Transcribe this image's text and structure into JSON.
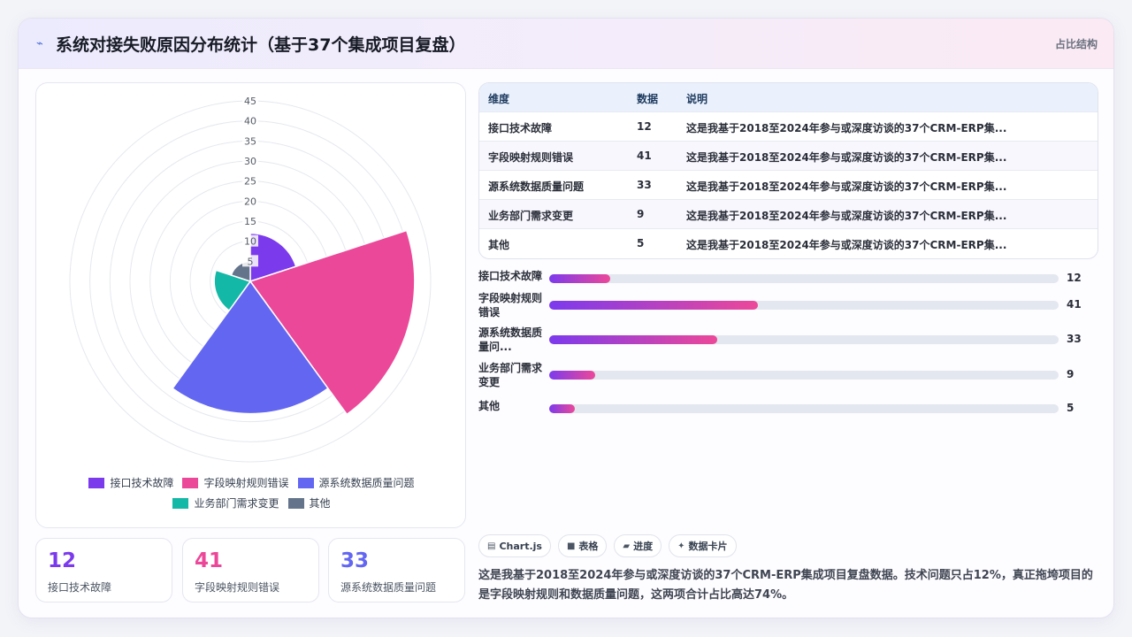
{
  "header": {
    "logo_icon": "line-chart-icon",
    "title": "系统对接失败原因分布统计（基于37个集成项目复盘）",
    "tag": "占比结构"
  },
  "chart_data": {
    "type": "polarArea",
    "categories": [
      "接口技术故障",
      "字段映射规则错误",
      "源系统数据质量问题",
      "业务部门需求变更",
      "其他"
    ],
    "values": [
      12,
      41,
      33,
      9,
      5
    ],
    "colors": [
      "#7c3aed",
      "#ec4899",
      "#6366f1",
      "#14b8a6",
      "#64748b"
    ],
    "r_ticks": [
      "5",
      "10",
      "15",
      "20",
      "25",
      "30",
      "35",
      "40",
      "45"
    ],
    "rlim": [
      0,
      45
    ],
    "legend_position": "bottom"
  },
  "kpis": [
    {
      "value": "12",
      "label": "接口技术故障",
      "color": "#7c3aed"
    },
    {
      "value": "41",
      "label": "字段映射规则错误",
      "color": "#ec4899"
    },
    {
      "value": "33",
      "label": "源系统数据质量问题",
      "color": "#6366f1"
    }
  ],
  "table": {
    "headers": [
      "维度",
      "数据",
      "说明"
    ],
    "rows": [
      [
        "接口技术故障",
        "12",
        "这是我基于2018至2024年参与或深度访谈的37个CRM-ERP集..."
      ],
      [
        "字段映射规则错误",
        "41",
        "这是我基于2018至2024年参与或深度访谈的37个CRM-ERP集..."
      ],
      [
        "源系统数据质量问题",
        "33",
        "这是我基于2018至2024年参与或深度访谈的37个CRM-ERP集..."
      ],
      [
        "业务部门需求变更",
        "9",
        "这是我基于2018至2024年参与或深度访谈的37个CRM-ERP集..."
      ],
      [
        "其他",
        "5",
        "这是我基于2018至2024年参与或深度访谈的37个CRM-ERP集..."
      ]
    ]
  },
  "bars": {
    "max": 100,
    "items": [
      {
        "label": "接口技术故障",
        "value": 12
      },
      {
        "label": "字段映射规则错误",
        "value": 41
      },
      {
        "label": "源系统数据质量问...",
        "value": 33
      },
      {
        "label": "业务部门需求变更",
        "value": 9
      },
      {
        "label": "其他",
        "value": 5
      }
    ]
  },
  "chips": [
    {
      "icon": "chart-icon",
      "glyph": "▤",
      "label": "Chart.js"
    },
    {
      "icon": "table-icon",
      "glyph": "■",
      "label": "表格"
    },
    {
      "icon": "progress-icon",
      "glyph": "▰",
      "label": "进度"
    },
    {
      "icon": "sparkle-icon",
      "glyph": "✦",
      "label": "数据卡片"
    }
  ],
  "note": "这是我基于2018至2024年参与或深度访谈的37个CRM-ERP集成项目复盘数据。技术问题只占12%，真正拖垮项目的是字段映射规则和数据质量问题，这两项合计占比高达74%。"
}
